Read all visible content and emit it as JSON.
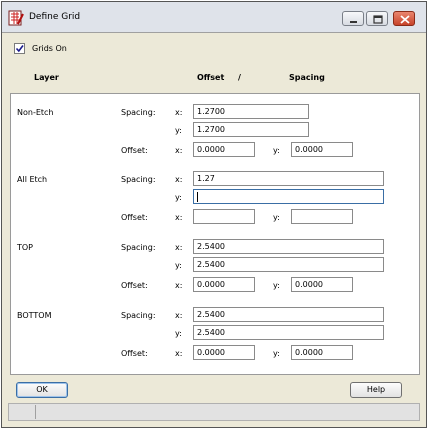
{
  "window": {
    "title": "Define Grid",
    "icon": "grid-app-icon"
  },
  "window_controls": [
    "minimize-icon",
    "maximize-icon",
    "close-icon"
  ],
  "grids_on": {
    "label": "Grids On",
    "checked": true
  },
  "headers": {
    "layer": "Layer",
    "offset": "Offset",
    "slash": "/",
    "spacing": "Spacing"
  },
  "labels": {
    "spacing": "Spacing:",
    "offset": "Offset:",
    "x": "x:",
    "y": "y:"
  },
  "layers": [
    {
      "name": "Non-Etch",
      "spacing_x": "1.2700",
      "spacing_y": "1.2700",
      "offset_x": "0.0000",
      "offset_y": "0.0000"
    },
    {
      "name": "All Etch",
      "spacing_x": "1.27",
      "spacing_y": "",
      "offset_x": "",
      "offset_y": ""
    },
    {
      "name": "TOP",
      "spacing_x": "2.5400",
      "spacing_y": "2.5400",
      "offset_x": "0.0000",
      "offset_y": "0.0000"
    },
    {
      "name": "BOTTOM",
      "spacing_x": "2.5400",
      "spacing_y": "2.5400",
      "offset_x": "0.0000",
      "offset_y": "0.0000"
    }
  ],
  "buttons": {
    "ok": "OK",
    "help": "Help"
  }
}
